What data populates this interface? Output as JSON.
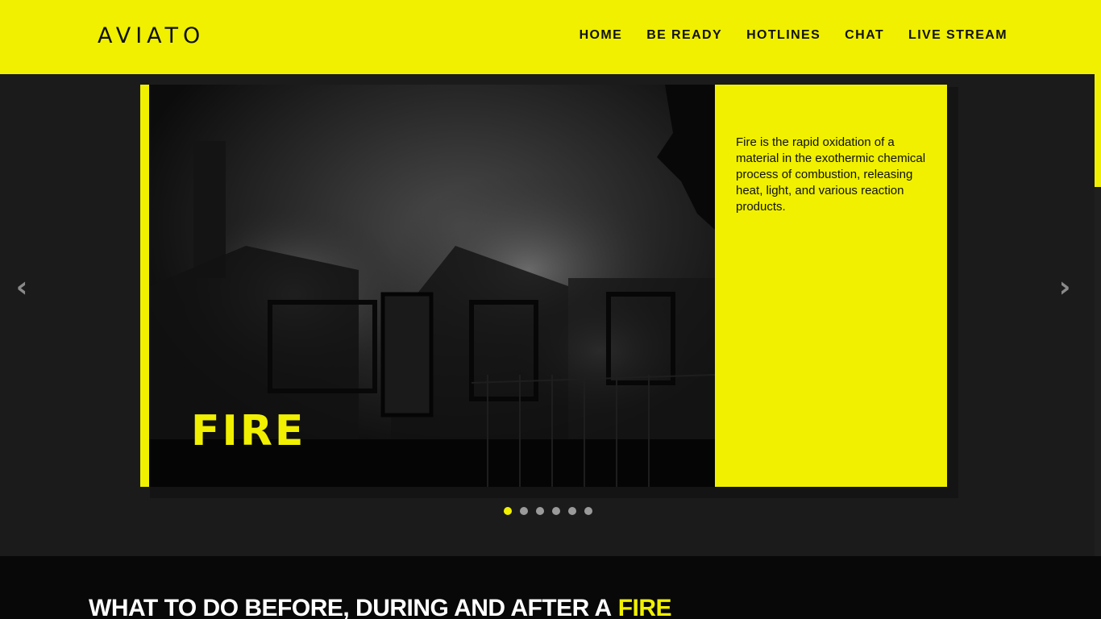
{
  "brand": {
    "logo": "AVIATO"
  },
  "nav": {
    "items": [
      {
        "label": "HOME"
      },
      {
        "label": "BE READY"
      },
      {
        "label": "HOTLINES"
      },
      {
        "label": "CHAT"
      },
      {
        "label": "LIVE STREAM"
      }
    ]
  },
  "slider": {
    "title": "FIRE",
    "description": "Fire is the rapid oxidation of a material in the exothermic chemical process of combustion, releasing heat, light, and various reaction products.",
    "prev_icon": "chevron-left-icon",
    "next_icon": "chevron-right-icon",
    "slide_count": 6,
    "active_index": 0
  },
  "section": {
    "heading": "WHAT TO DO BEFORE, DURING AND AFTER A",
    "highlight": "FIRE"
  },
  "colors": {
    "accent": "#f0f000",
    "background": "#1b1b1b",
    "section_background": "#080808"
  }
}
